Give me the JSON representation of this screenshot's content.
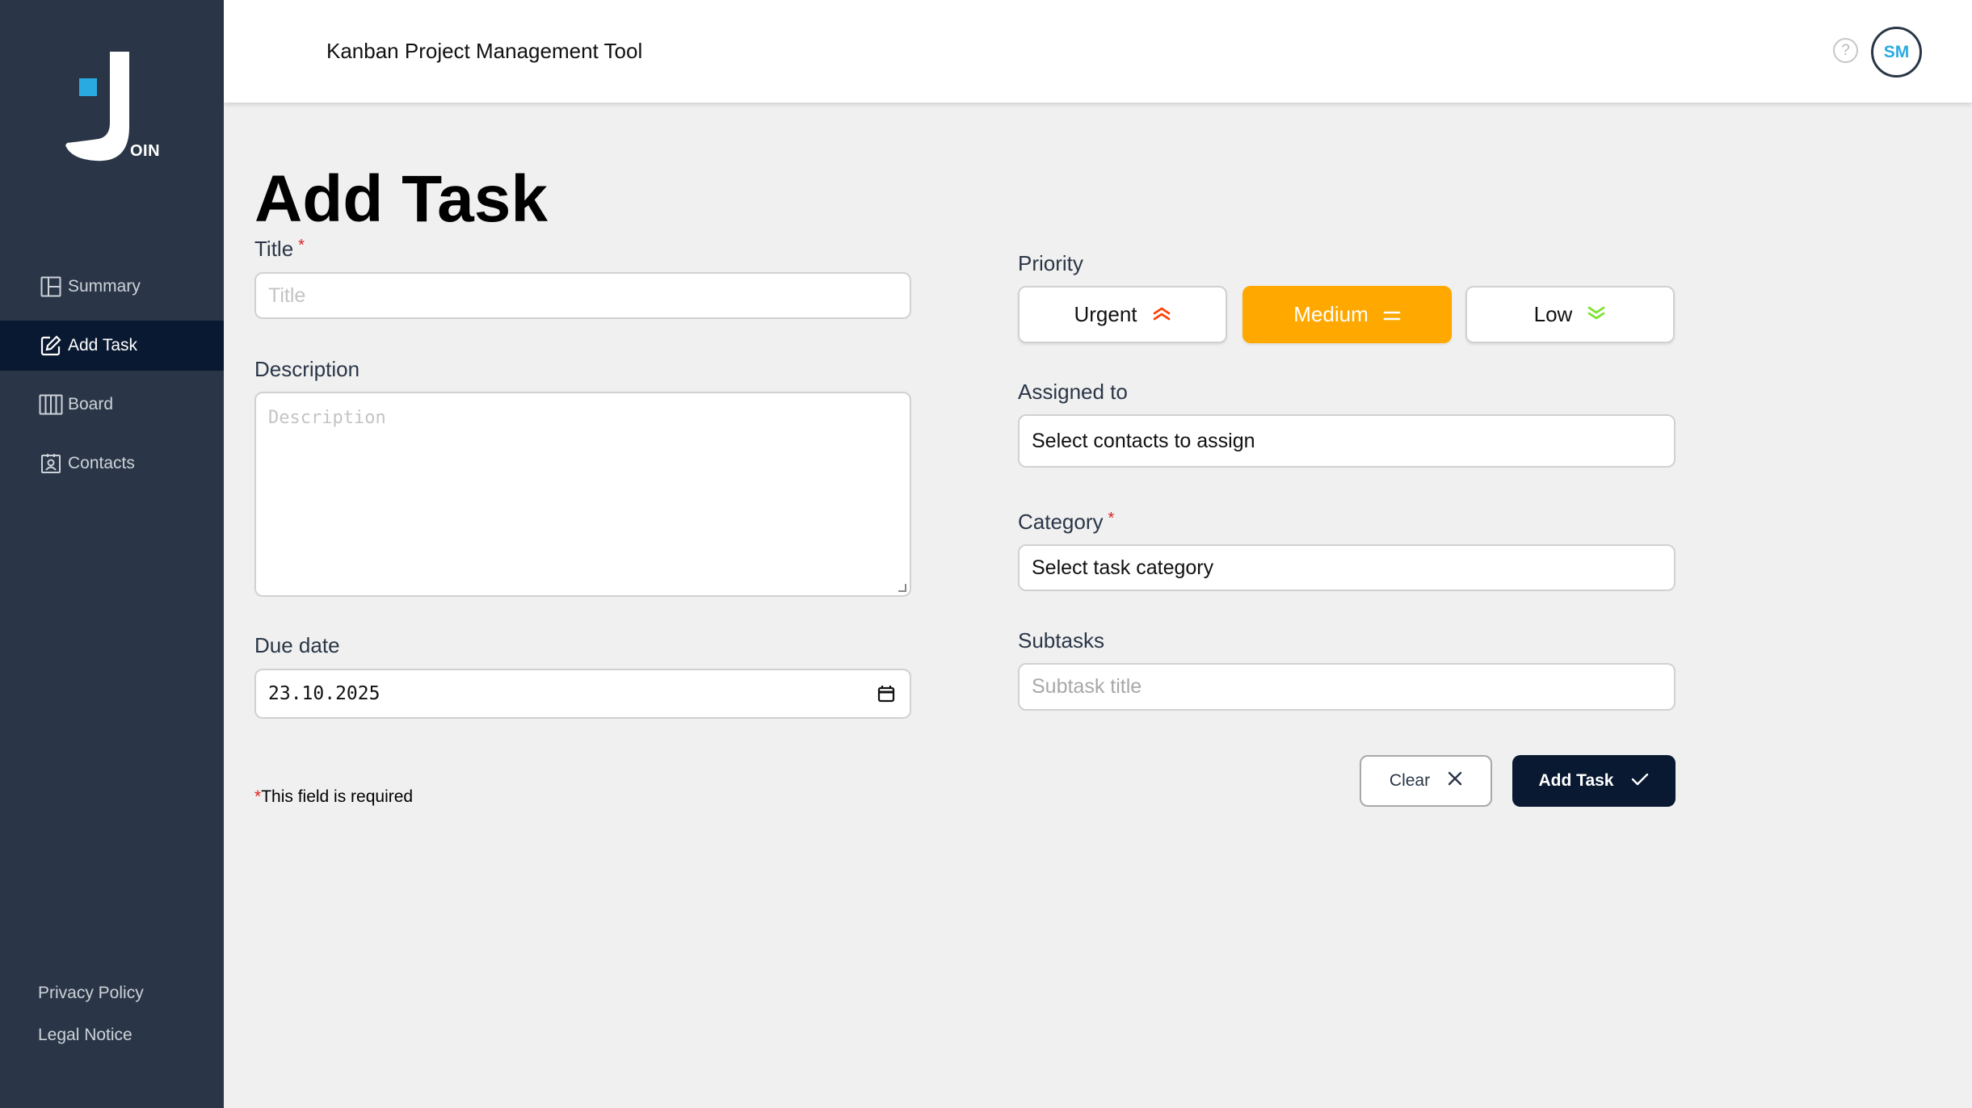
{
  "app": {
    "title": "Kanban Project Management Tool",
    "logo_text": "OIN"
  },
  "header": {
    "help_icon": "?",
    "user_initials": "SM"
  },
  "sidebar": {
    "items": [
      {
        "label": "Summary",
        "icon": "summary-icon"
      },
      {
        "label": "Add Task",
        "icon": "edit-icon",
        "active": true
      },
      {
        "label": "Board",
        "icon": "board-icon"
      },
      {
        "label": "Contacts",
        "icon": "contacts-icon"
      }
    ],
    "footer": {
      "privacy": "Privacy Policy",
      "legal": "Legal Notice"
    }
  },
  "form": {
    "heading": "Add Task",
    "title": {
      "label": "Title",
      "required_mark": "*",
      "placeholder": "Title"
    },
    "description": {
      "label": "Description",
      "placeholder": "Description"
    },
    "due_date": {
      "label": "Due date",
      "value": "23.10.2025"
    },
    "priority": {
      "label": "Priority",
      "options": [
        {
          "label": "Urgent",
          "color": "#ff3d00"
        },
        {
          "label": "Medium",
          "color": "#ffa800",
          "selected": true
        },
        {
          "label": "Low",
          "color": "#7ae229"
        }
      ]
    },
    "assigned": {
      "label": "Assigned to",
      "value": "Select contacts to assign"
    },
    "category": {
      "label": "Category",
      "required_mark": "*",
      "value": "Select task category"
    },
    "subtasks": {
      "label": "Subtasks",
      "placeholder": "Subtask title"
    },
    "required_note": {
      "star": "*",
      "text": "This field is required"
    },
    "buttons": {
      "clear": "Clear",
      "add": "Add Task"
    }
  },
  "colors": {
    "sidebar": "#2a3647",
    "active_nav": "#091931",
    "accent_blue": "#29abe2",
    "medium": "#ffa800"
  }
}
